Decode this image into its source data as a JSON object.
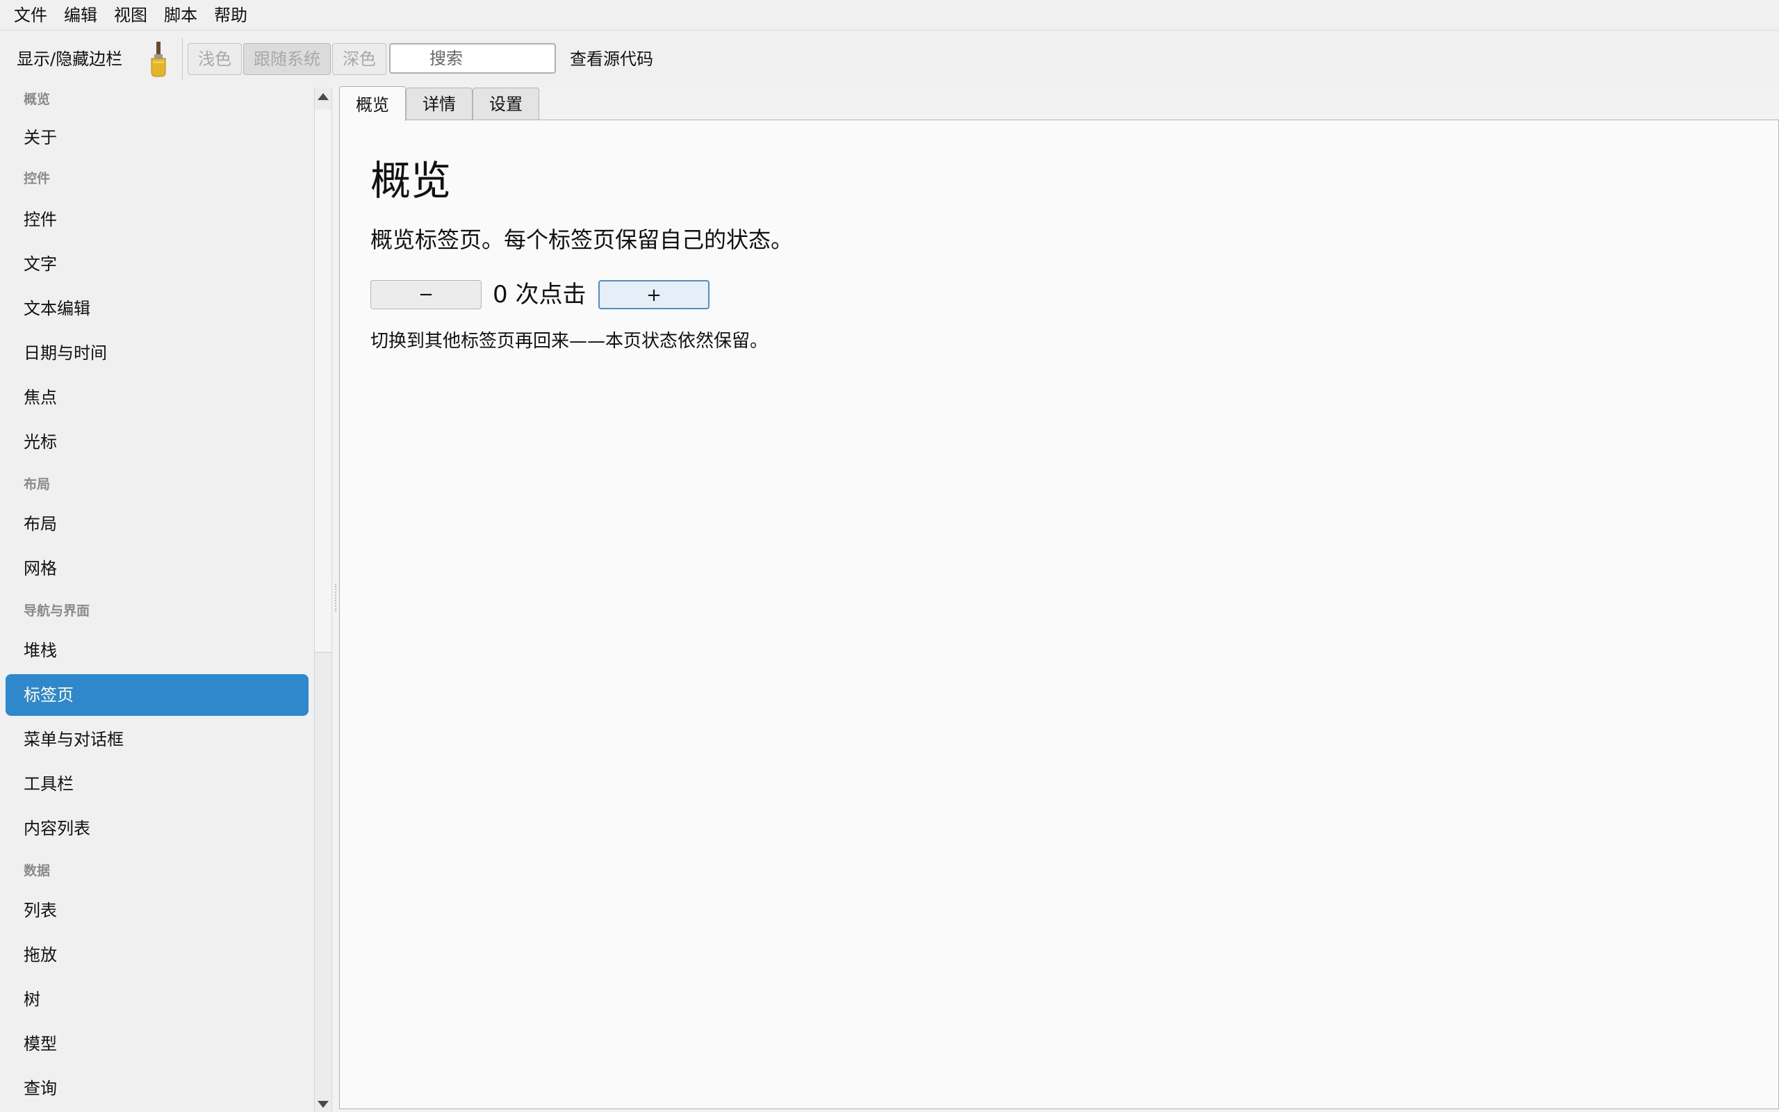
{
  "menu": [
    "文件",
    "编辑",
    "视图",
    "脚本",
    "帮助"
  ],
  "toolbar": {
    "sidebar_toggle": "显示/隐藏边栏",
    "brush_icon": "paintbrush-icon",
    "theme_light": "浅色",
    "theme_system": "跟随系统",
    "theme_dark": "深色",
    "search_placeholder": "搜索",
    "view_source": "查看源代码"
  },
  "sidebar": {
    "sections": {
      "overview": "概览",
      "widgets": "控件",
      "layout": "布局",
      "navigation": "导航与界面",
      "data": "数据"
    },
    "items": {
      "about": "关于",
      "widgets": "控件",
      "text": "文字",
      "text_edit": "文本编辑",
      "datetime": "日期与时间",
      "focus": "焦点",
      "cursor": "光标",
      "layout": "布局",
      "grid": "网格",
      "stack": "堆栈",
      "tabs": "标签页",
      "menus_dialogs": "菜单与对话框",
      "toolbar": "工具栏",
      "content_list": "内容列表",
      "list": "列表",
      "drag_drop": "拖放",
      "tree": "树",
      "model": "模型",
      "query": "查询"
    },
    "active": "标签页"
  },
  "tabs": {
    "overview": "概览",
    "details": "详情",
    "settings": "设置",
    "active": "概览"
  },
  "panel": {
    "title": "概览",
    "description": "概览标签页。每个标签页保留自己的状态。",
    "minus_label": "−",
    "plus_label": "+",
    "counter_text": "0 次点击",
    "hint": "切换到其他标签页再回来——本页状态依然保留。"
  }
}
